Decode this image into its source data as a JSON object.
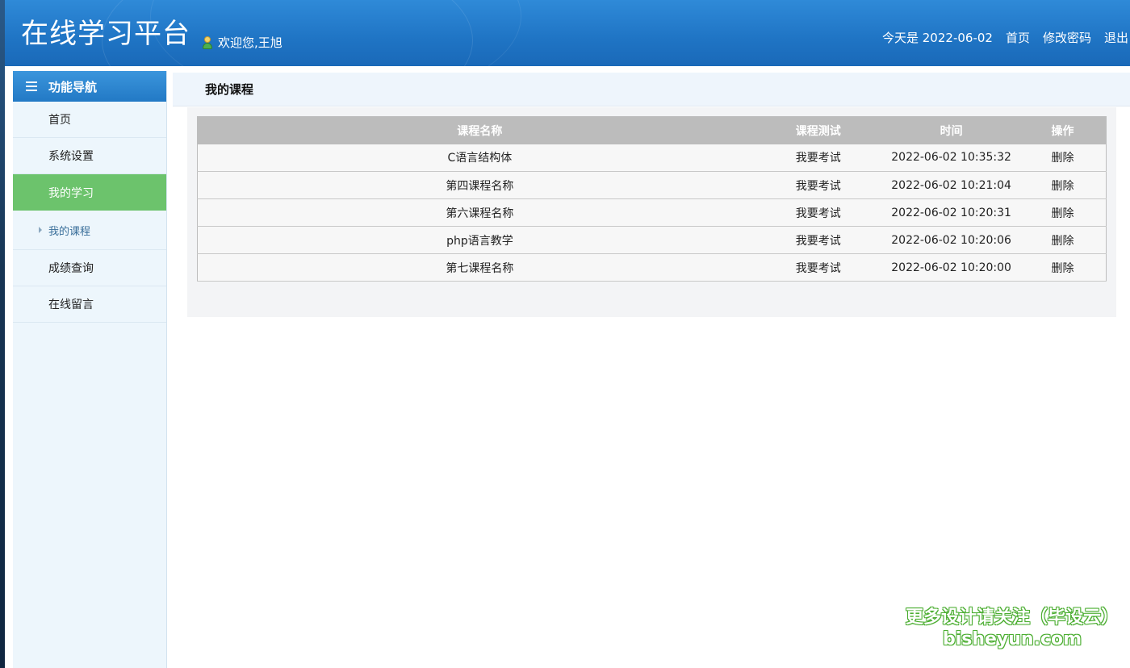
{
  "header": {
    "logo": "在线学习平台",
    "welcome": "欢迎您,王旭",
    "date": "今天是 2022-06-02",
    "nav": [
      "首页",
      "修改密码",
      "退出"
    ]
  },
  "sidebar": {
    "title": "功能导航",
    "items": [
      {
        "label": "首页"
      },
      {
        "label": "系统设置"
      },
      {
        "label": "我的学习"
      },
      {
        "label": "我的课程"
      },
      {
        "label": "成绩查询"
      },
      {
        "label": "在线留言"
      }
    ]
  },
  "main": {
    "title": "我的课程",
    "table": {
      "headers": [
        "课程名称",
        "课程测试",
        "时间",
        "操作"
      ],
      "rows": [
        {
          "name": "C语言结构体",
          "exam": "我要考试",
          "time": "2022-06-02 10:35:32",
          "action": "删除"
        },
        {
          "name": "第四课程名称",
          "exam": "我要考试",
          "time": "2022-06-02 10:21:04",
          "action": "删除"
        },
        {
          "name": "第六课程名称",
          "exam": "我要考试",
          "time": "2022-06-02 10:20:31",
          "action": "删除"
        },
        {
          "name": "php语言教学",
          "exam": "我要考试",
          "time": "2022-06-02 10:20:06",
          "action": "删除"
        },
        {
          "name": "第七课程名称",
          "exam": "我要考试",
          "time": "2022-06-02 10:20:00",
          "action": "删除"
        }
      ]
    }
  },
  "watermark": {
    "line1": "更多设计请关注（毕设云）",
    "line2": "bisheyun.com"
  }
}
